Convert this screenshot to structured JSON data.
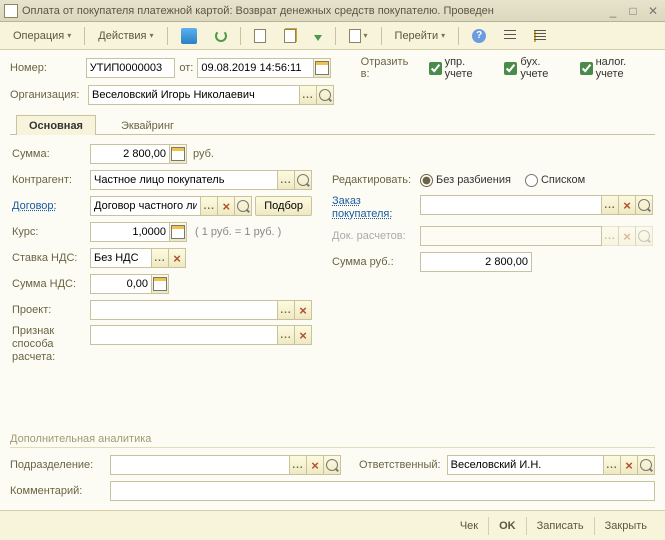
{
  "window": {
    "title": "Оплата от покупателя платежной картой: Возврат денежных средств покупателю. Проведен"
  },
  "toolbar": {
    "operation": "Операция",
    "actions": "Действия",
    "goto": "Перейти",
    "help": "?"
  },
  "header": {
    "number_lbl": "Номер:",
    "number": "УТИП0000003",
    "from_lbl": "от:",
    "date": "09.08.2019 14:56:11",
    "reflect_lbl": "Отразить в:",
    "chk_upr": "упр. учете",
    "chk_bukh": "бух. учете",
    "chk_nalog": "налог. учете",
    "org_lbl": "Организация:",
    "org": "Веселовский Игорь Николаевич"
  },
  "tabs": {
    "main": "Основная",
    "acq": "Эквайринг"
  },
  "main": {
    "sum_lbl": "Сумма:",
    "sum": "2 800,00",
    "rub": "руб.",
    "contr_lbl": "Контрагент:",
    "contr": "Частное лицо покупатель",
    "dog_lbl": "Договор:",
    "dog": "Договор частного лица",
    "pick": "Подбор",
    "rate_lbl": "Курс:",
    "rate": "1,0000",
    "rate_hint": "( 1 руб. = 1 руб. )",
    "nds_lbl": "Ставка НДС:",
    "nds": "Без НДС",
    "ndssum_lbl": "Сумма НДС:",
    "ndssum": "0,00",
    "proj_lbl": "Проект:",
    "proj": "",
    "priznak_lbl": "Признак способа расчета:",
    "priznak": ""
  },
  "right": {
    "edit_lbl": "Редактировать:",
    "r_no_split": "Без разбиения",
    "r_list": "Списком",
    "order_lbl": "Заказ покупателя:",
    "order": "",
    "docrasch_lbl": "Док. расчетов:",
    "docrasch": "",
    "sumrub_lbl": "Сумма руб.:",
    "sumrub": "2 800,00"
  },
  "analytics": {
    "hdr": "Дополнительная аналитика",
    "podr_lbl": "Подразделение:",
    "podr": "",
    "resp_lbl": "Ответственный:",
    "resp": "Веселовский И.Н.",
    "comment_lbl": "Комментарий:",
    "comment": ""
  },
  "buttons": {
    "check": "Чек",
    "ok": "OK",
    "write": "Записать",
    "close": "Закрыть"
  }
}
